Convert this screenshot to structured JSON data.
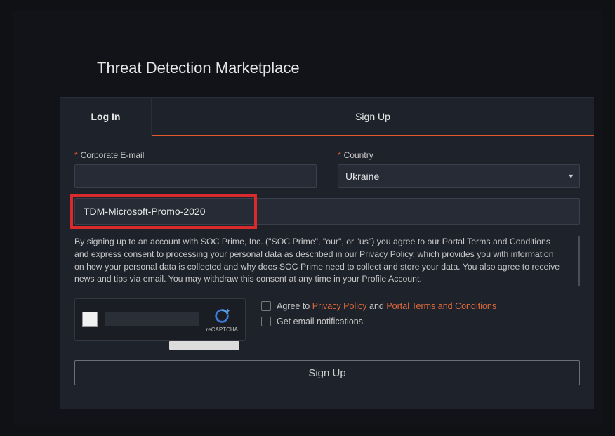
{
  "page_title": "Threat Detection Marketplace",
  "tabs": {
    "login": "Log In",
    "signup": "Sign Up"
  },
  "fields": {
    "email_label": "Corporate E-mail",
    "country_label": "Country",
    "country_value": "Ukraine",
    "promo_value": "TDM-Microsoft-Promo-2020"
  },
  "consent_text": "By signing up to an account with SOC Prime, Inc. (\"SOC Prime\", \"our\", or \"us\") you agree to our Portal Terms and Conditions and express consent to processing your personal data as described in our Privacy Policy, which provides you with information on how your personal data is collected and why does SOC Prime need to collect and store your data. You also agree to receive news and tips via email. You may withdraw this consent at any time in your Profile Account.",
  "recaptcha_label": "reCAPTCHA",
  "checks": {
    "agree_prefix": "Agree to ",
    "privacy": "Privacy Policy",
    "and": " and ",
    "terms": "Portal Terms and Conditions",
    "emails": "Get email notifications"
  },
  "signup_button": "Sign Up"
}
